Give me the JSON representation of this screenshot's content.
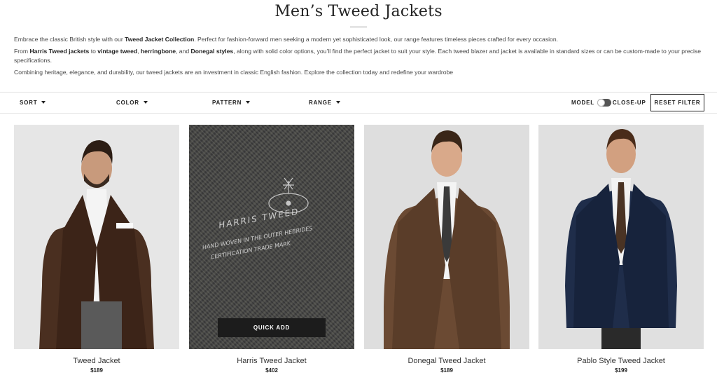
{
  "page": {
    "title": "Men’s Tweed Jackets",
    "intro": [
      {
        "parts": [
          {
            "t": "Embrace the classic British style with our ",
            "b": false
          },
          {
            "t": "Tweed Jacket Collection",
            "b": true
          },
          {
            "t": ". Perfect for fashion-forward men seeking a modern yet sophisticated look, our range features timeless pieces crafted for every occasion.",
            "b": false
          }
        ]
      },
      {
        "parts": [
          {
            "t": "From ",
            "b": false
          },
          {
            "t": "Harris Tweed jackets",
            "b": true
          },
          {
            "t": " to ",
            "b": false
          },
          {
            "t": "vintage tweed",
            "b": true
          },
          {
            "t": ", ",
            "b": false
          },
          {
            "t": "herringbone",
            "b": true
          },
          {
            "t": ", and ",
            "b": false
          },
          {
            "t": "Donegal styles",
            "b": true
          },
          {
            "t": ", along with solid color options, you’ll find the perfect jacket to suit your style. Each tweed blazer and jacket is available in standard sizes or can be custom-made to your precise specifications.",
            "b": false
          }
        ]
      },
      {
        "parts": [
          {
            "t": "Combining heritage, elegance, and durability, our tweed jackets are an investment in classic English fashion. Explore the collection today and redefine your wardrobe",
            "b": false
          }
        ]
      }
    ]
  },
  "filters": {
    "sort": "SORT",
    "color": "COLOR",
    "pattern": "PATTERN",
    "range": "RANGE",
    "toggle_left": "MODEL",
    "toggle_right": "CLOSE-UP",
    "reset": "RESET FILTER"
  },
  "products": [
    {
      "name": "Tweed Jacket",
      "price": "$189",
      "jacket_color": "#4a2f20",
      "shirt": "#f4f4f4",
      "trousers": "#5a5a5a",
      "bg": "#e6e6e6"
    },
    {
      "name": "Harris Tweed Jacket",
      "price": "$402",
      "quick_add": "QUICK ADD",
      "label_lines": [
        "HARRIS TWEED",
        "HAND WOVEN IN THE OUTER HEBRIDES",
        "CERTIFICATION TRADE MARK"
      ]
    },
    {
      "name": "Donegal Tweed Jacket",
      "price": "$189",
      "jacket_color": "#6b4a33",
      "shirt": "#f4f4f4",
      "tie": "#3a3a3a",
      "bg": "#dedede"
    },
    {
      "name": "Pablo Style Tweed Jacket",
      "price": "$199",
      "jacket_color": "#1f2d4a",
      "shirt": "#f2f2f2",
      "tie": "#4a3324",
      "bg": "#e0e0e0"
    }
  ]
}
